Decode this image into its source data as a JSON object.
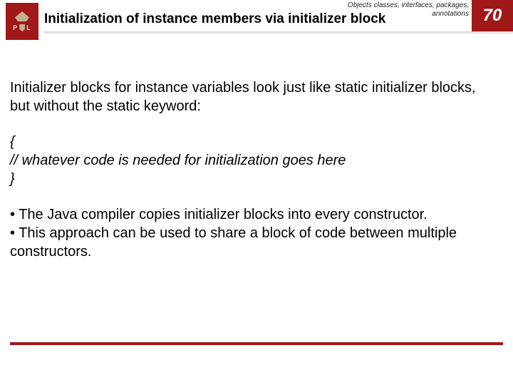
{
  "header": {
    "logo_letters_left": "P",
    "logo_letters_right": "L",
    "breadcrumb_line1": "Objects classes, interfaces, packages,",
    "breadcrumb_line2": "annotations",
    "title": "Initialization of instance members via initializer block",
    "page_number": "70"
  },
  "body": {
    "intro": "Initializer blocks for instance variables look just like static initializer blocks, but without the static keyword:",
    "code": {
      "open": "{",
      "line": "// whatever code is needed for initialization goes here",
      "close": "}"
    },
    "bullet1": "• The Java compiler copies initializer blocks into every constructor.",
    "bullet2": "• This approach can be used to share a block of code between multiple constructors."
  }
}
